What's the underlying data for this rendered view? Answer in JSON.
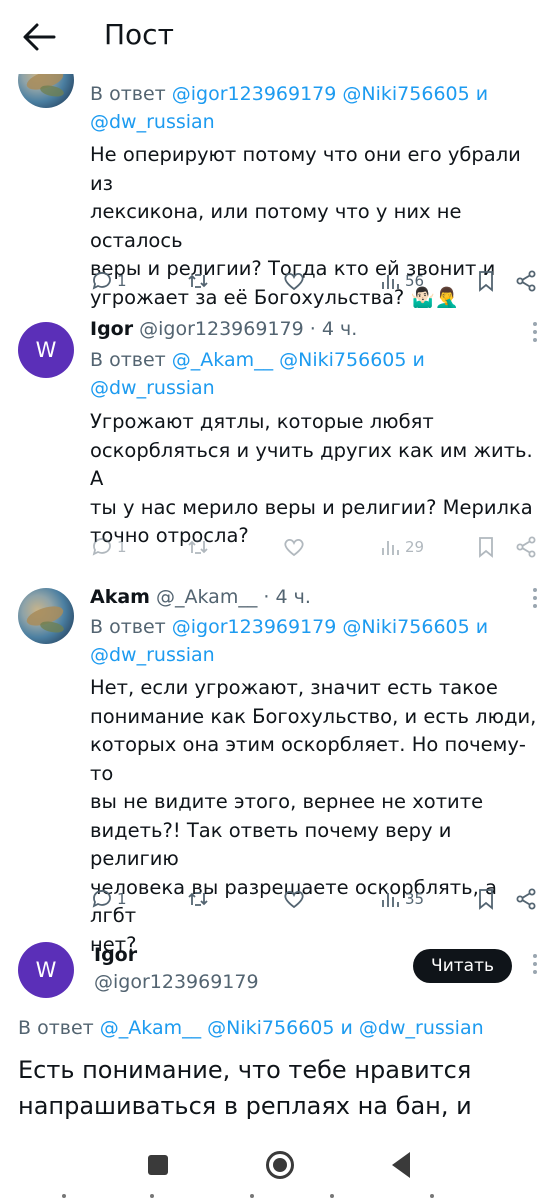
{
  "header": {
    "title": "Пост"
  },
  "tweets": [
    {
      "reply_prefix": "В ответ",
      "reply_mentions": [
        "@igor123969179",
        "@Niki756605"
      ],
      "reply_and": "и",
      "reply_mention_last": "@dw_russian",
      "lines": [
        "Не оперируют потому что они его убрали из",
        "лексикона, или потому что у них не осталось",
        "веры и религии? Тогда кто ей звонит и",
        "угрожает за её Богохульства? 🤷🏻‍♂️🤦‍♂️"
      ],
      "stats": {
        "replies": "1",
        "retweets": "",
        "likes": "",
        "views": "56"
      }
    },
    {
      "avatar_letter": "W",
      "name": "Igor",
      "handle": "@igor123969179",
      "time": "· 4 ч.",
      "reply_prefix": "В ответ",
      "reply_mentions": [
        "@_Akam__",
        "@Niki756605"
      ],
      "reply_and": "и",
      "reply_mention_last": "@dw_russian",
      "lines": [
        "Угрожают дятлы, которые любят",
        "оскорбляться и учить других как им жить. А",
        "ты у нас мерило веры и религии? Мерилка",
        "точно отросла?"
      ],
      "stats": {
        "replies": "1",
        "retweets": "",
        "likes": "",
        "views": "29"
      }
    },
    {
      "name": "Akam",
      "handle": "@_Akam__",
      "time": "· 4 ч.",
      "reply_prefix": "В ответ",
      "reply_mentions": [
        "@igor123969179",
        "@Niki756605"
      ],
      "reply_and": "и",
      "reply_mention_last": "@dw_russian",
      "lines": [
        "Нет, если угрожают, значит есть такое",
        "понимание как Богохульство, и есть люди,",
        "которых она этим оскорбляет. Но почему-то",
        "вы не видите этого, вернее не хотите",
        "видеть?! Так ответь почему веру и религию",
        "человека вы разрешаете оскорблять, а лгбт",
        "нет?"
      ],
      "stats": {
        "replies": "1",
        "retweets": "",
        "likes": "",
        "views": "35"
      }
    }
  ],
  "focused": {
    "avatar_letter": "W",
    "name": "Igor",
    "handle": "@igor123969179",
    "follow_label": "Читать",
    "reply_prefix": "В ответ",
    "reply_mentions": [
      "@_Akam__",
      "@Niki756605"
    ],
    "reply_and": "и",
    "reply_mention_last": "@dw_russian",
    "lines": [
      "Есть понимание, что тебе нравится",
      "напрашиваться в реплаях на бан, и"
    ]
  },
  "icons": {
    "back": "arrow-left-icon",
    "reply": "reply-bubble-icon",
    "retweet": "retweet-icon",
    "like": "heart-icon",
    "views": "views-bar-icon",
    "bookmark": "bookmark-icon",
    "share": "share-icon",
    "more": "more-vertical-icon"
  },
  "colors": {
    "accent": "#1d9bf0",
    "avatar_w": "#5b2fb8",
    "text": "#0f1419",
    "muted": "#536471"
  }
}
